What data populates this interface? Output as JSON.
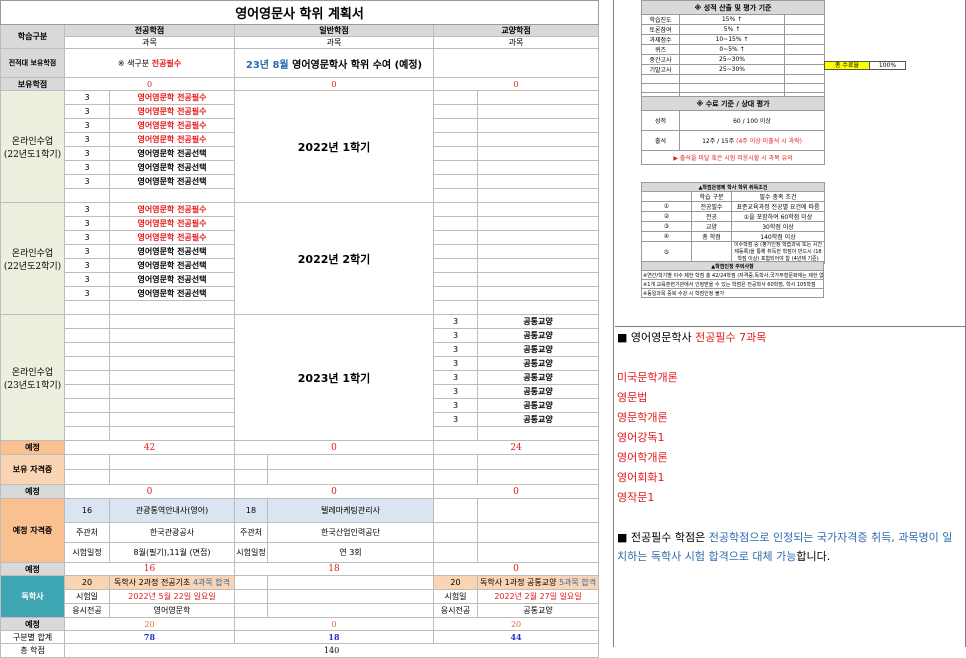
{
  "title": "영어영문사 학위 계획서",
  "header": {
    "col_group": "학습구분",
    "major": "전공학점",
    "general": "일반학점",
    "liberal": "교양학점",
    "subject": "과목"
  },
  "prev_credit": {
    "label": "전적대 보유학점",
    "legend_prefix": "※ 색구분",
    "legend_required": "전공필수",
    "plan_prefix": "23년 8월",
    "plan_text": "영어영문학사 학위 수여 (예정)"
  },
  "held_credit": {
    "label": "보유학점",
    "major": "0",
    "general": "0",
    "liberal": "0"
  },
  "sem1": {
    "label": "온라인수업\n(22년도1학기)",
    "term": "2022년 1학기",
    "rows": [
      {
        "credit": "3",
        "name": "영어영문학 전공필수",
        "req": true
      },
      {
        "credit": "3",
        "name": "영어영문학 전공필수",
        "req": true
      },
      {
        "credit": "3",
        "name": "영어영문학 전공필수",
        "req": true
      },
      {
        "credit": "3",
        "name": "영어영문학 전공필수",
        "req": true
      },
      {
        "credit": "3",
        "name": "영어영문학 전공선택",
        "req": false
      },
      {
        "credit": "3",
        "name": "영어영문학 전공선택",
        "req": false
      },
      {
        "credit": "3",
        "name": "영어영문학 전공선택",
        "req": false
      }
    ]
  },
  "sem2": {
    "label": "온라인수업\n(22년도2학기)",
    "term": "2022년 2학기",
    "rows": [
      {
        "credit": "3",
        "name": "영어영문학 전공필수",
        "req": true
      },
      {
        "credit": "3",
        "name": "영어영문학 전공필수",
        "req": true
      },
      {
        "credit": "3",
        "name": "영어영문학 전공필수",
        "req": true
      },
      {
        "credit": "3",
        "name": "영어영문학 전공선택",
        "req": false
      },
      {
        "credit": "3",
        "name": "영어영문학 전공선택",
        "req": false
      },
      {
        "credit": "3",
        "name": "영어영문학 전공선택",
        "req": false
      },
      {
        "credit": "3",
        "name": "영어영문학 전공선택",
        "req": false
      }
    ]
  },
  "sem3": {
    "label": "온라인수업\n(23년도1학기)",
    "term": "2023년 1학기",
    "rows": [
      {
        "credit": "3",
        "name": "공통교양"
      },
      {
        "credit": "3",
        "name": "공통교양"
      },
      {
        "credit": "3",
        "name": "공통교양"
      },
      {
        "credit": "3",
        "name": "공통교양"
      },
      {
        "credit": "3",
        "name": "공통교양"
      },
      {
        "credit": "3",
        "name": "공통교양"
      },
      {
        "credit": "3",
        "name": "공통교양"
      },
      {
        "credit": "3",
        "name": "공통교양"
      }
    ]
  },
  "planned1": {
    "label": "예정",
    "major": "42",
    "general": "0",
    "liberal": "24"
  },
  "held_cert": {
    "label": "보유 자격증"
  },
  "planned2": {
    "label": "예정",
    "major": "0",
    "general": "0",
    "liberal": "0"
  },
  "planned_cert": {
    "label": "예정 자격증",
    "c1_credit": "16",
    "c1_name": "관광통역안내사(영어)",
    "c2_credit": "18",
    "c2_name": "텔레마케팅관리사",
    "host_label": "주관처",
    "c1_host": "한국관광공사",
    "c2_host": "한국산업인력공단",
    "sched_label": "시험일정",
    "c1_sched": "8월(필기),11월 (면접)",
    "c2_sched": "연 3회"
  },
  "planned3": {
    "label": "예정",
    "major": "16",
    "general": "18",
    "liberal": "0"
  },
  "self_study": {
    "label": "독학사",
    "m_credit": "20",
    "m_text": "독학사 2과정 전공기초",
    "m_pass": "4과목 합격",
    "l_credit": "20",
    "l_text": "독학사 1과정 공통교양",
    "l_pass": "5과목 합격",
    "date_label": "시험일",
    "m_date": "2022년 5월 22일 일요일",
    "l_date": "2022년 2월 27일 일요일",
    "major_label": "응시전공",
    "m_major": "영어영문학",
    "l_major": "공통교양"
  },
  "planned4": {
    "label": "예정",
    "major": "20",
    "general": "0",
    "liberal": "20"
  },
  "subtotal": {
    "label": "구분별 합계",
    "major": "78",
    "general": "18",
    "liberal": "44"
  },
  "total": {
    "label": "총 학점",
    "value": "140"
  },
  "panel1": {
    "title": "※ 성적 산출 및 평가 기준",
    "rows": [
      [
        "학습진도",
        "15% ↑"
      ],
      [
        "토론참여",
        "5% ↑"
      ],
      [
        "과제점수",
        "10~15% ↑"
      ],
      [
        "퀴즈",
        "0~5% ↑"
      ],
      [
        "중간고사",
        "25~30%"
      ],
      [
        "기말고사",
        "25~30%"
      ]
    ],
    "done_label": "총 수료율",
    "done_value": "100%"
  },
  "panel2": {
    "title": "※ 수료 기준 / 상대 평가",
    "grade_label": "성적",
    "grade_value": "60 / 100 이상",
    "att_label": "출석",
    "att_value": "12주 / 15주",
    "att_note": "(4주 이상 미출석 시 과락)",
    "warning": "▶ 출석을 미달 혹은 시험 미응시할 시 과목 유의"
  },
  "panel3": {
    "title": "▲학점은행제 학사 학위 취득조건",
    "head": [
      "학습 구분",
      "필수 충족 조건"
    ],
    "rows": [
      [
        "①",
        "전공필수",
        "표준교육과정 전공별 요건에 따름"
      ],
      [
        "②",
        "전공",
        "①을 포함하여 60학점 이상"
      ],
      [
        "③",
        "교양",
        "30학점 이상"
      ],
      [
        "④",
        "총 학점",
        "140학점 이상"
      ],
      [
        "⑤",
        "",
        "이수학점 중 (평가인정 학습과목 또는 시간제등록)을 통해 취득한 학점이 반드시 (18학점 이상) 포함되어야 함 (4년제 기준)"
      ]
    ]
  },
  "panel4": {
    "title": "▲학점인정 주의사항",
    "lines": [
      "※연간/학기별 이수 제한 학점 총 42/24학점 (자격증,독학사,국가무형문화재는 제한 없음)",
      "※1개 교육훈련기관에서 인정받을 수 있는 학점은 전공학사 60학점, 학사 105학점",
      "※동일과목 중복 수강 시 학점인정 불가"
    ]
  },
  "right_text": {
    "heading_prefix": "■ 영어영문학사 ",
    "heading_red": "전공필수 7과목",
    "subjects": [
      "미국문학개론",
      "영문법",
      "영문학개론",
      "영어강독1",
      "영어학개론",
      "영어회화1",
      "영작문1"
    ],
    "note_p1": "■ 전공필수 학점은 ",
    "note_p2": "전공학점으로 인정되는 국가자격증 취득, 과목명이 일치하는 독학사 시험 합격으로 대체 가능",
    "note_p3": "합니다."
  },
  "colors": {
    "green": "#ebf1de",
    "orange": "#fbd4b4",
    "gray": "#d9d9d9",
    "red": "#e41b1b",
    "blue": "#2e6bb0",
    "navy": "#2e2ed1",
    "yellow": "#ffff00"
  }
}
